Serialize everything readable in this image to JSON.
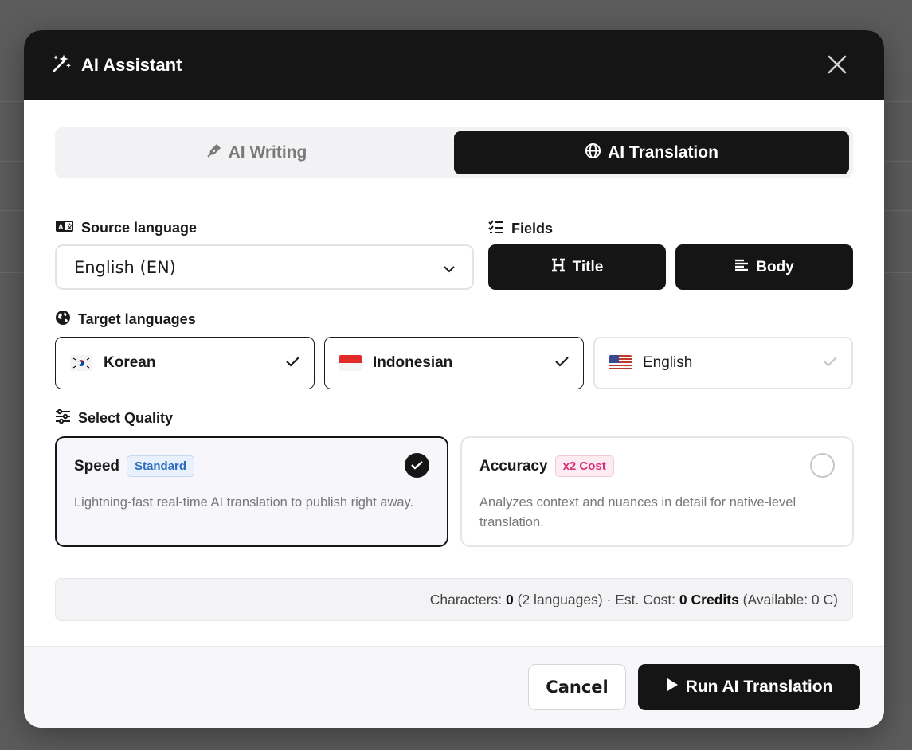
{
  "modal": {
    "title": "AI Assistant"
  },
  "tabs": [
    {
      "label": "AI Writing",
      "active": false
    },
    {
      "label": "AI Translation",
      "active": true
    }
  ],
  "source": {
    "label": "Source language",
    "value": "English (EN)"
  },
  "fields": {
    "label": "Fields",
    "items": [
      "Title",
      "Body"
    ]
  },
  "targets": {
    "label": "Target languages",
    "items": [
      {
        "name": "Korean",
        "selected": true
      },
      {
        "name": "Indonesian",
        "selected": true
      },
      {
        "name": "English",
        "selected": false
      }
    ]
  },
  "quality": {
    "label": "Select Quality",
    "options": [
      {
        "name": "Speed",
        "badge": "Standard",
        "desc": "Lightning-fast real-time AI translation to publish right away.",
        "selected": true
      },
      {
        "name": "Accuracy",
        "badge": "x2 Cost",
        "desc": "Analyzes context and nuances in detail for native-level translation.",
        "selected": false
      }
    ]
  },
  "summary": {
    "chars_label": "Characters: ",
    "chars": "0",
    "langs": " (2 languages) · Est. Cost: ",
    "cost": "0 Credits",
    "available": " (Available: 0 C)"
  },
  "footer": {
    "cancel": "Cancel",
    "run": "Run AI Translation"
  },
  "colors": {
    "header_bg": "#151515",
    "accent_blue": "#2f6cc0",
    "accent_pink": "#d6307a"
  }
}
